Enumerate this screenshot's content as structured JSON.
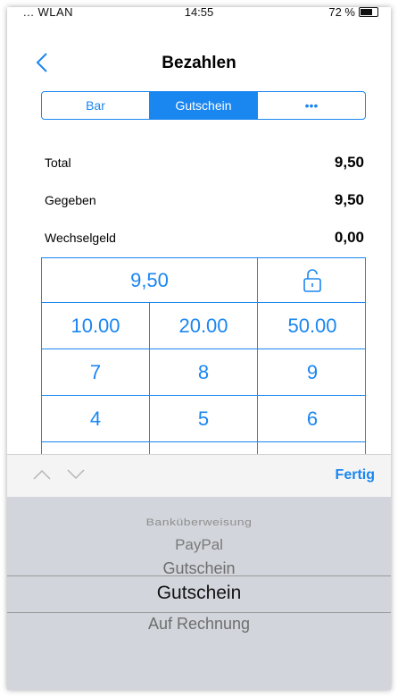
{
  "status_bar": {
    "carrier": "... WLAN",
    "time": "14:55",
    "battery": "72 %"
  },
  "nav": {
    "title": "Bezahlen",
    "back_icon": "chevron-left-icon"
  },
  "segment": {
    "items": [
      "Bar",
      "Gutschein",
      "•••"
    ],
    "active_index": 1
  },
  "summary": [
    {
      "label": "Total",
      "value": "9,50"
    },
    {
      "label": "Gegeben",
      "value": "9,50"
    },
    {
      "label": "Wechselgeld",
      "value": "0,00"
    }
  ],
  "keypad": {
    "display": "9,50",
    "lock_icon": "unlock-icon",
    "quick_amounts": [
      "10.00",
      "20.00",
      "50.00"
    ],
    "rows": [
      [
        "7",
        "8",
        "9"
      ],
      [
        "4",
        "5",
        "6"
      ]
    ]
  },
  "accessory": {
    "done_label": "Fertig",
    "prev_icon": "chevron-up-icon",
    "next_icon": "chevron-down-icon"
  },
  "picker": {
    "items": [
      "Banküberweisung",
      "PayPal",
      "Gutschein",
      "Gutschein",
      "Auf Rechnung"
    ],
    "selected_index": 3
  },
  "colors": {
    "accent": "#1a86f0",
    "picker_bg": "#d2d5db",
    "accessory_bg": "#f4f4f4"
  }
}
